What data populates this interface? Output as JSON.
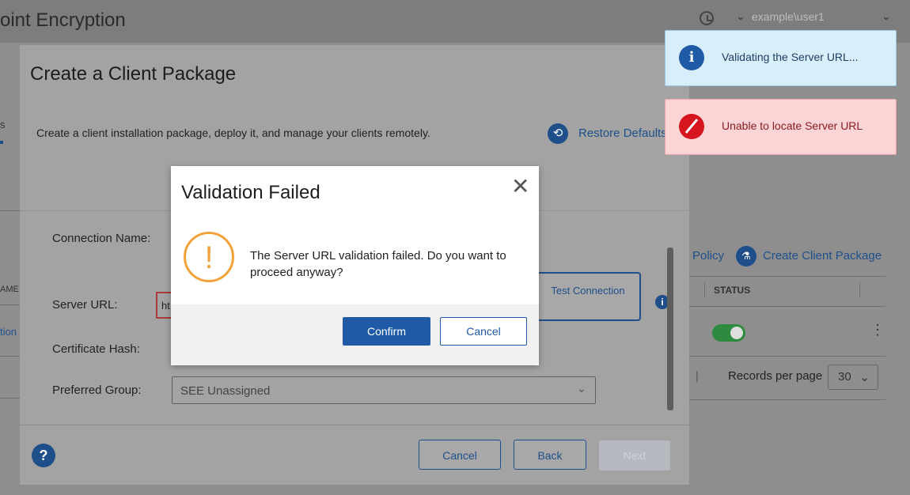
{
  "app": {
    "title": "oint Encryption"
  },
  "header": {
    "user": "example\\user1",
    "user_chevron": "⌄",
    "menu_chevron": "⌄"
  },
  "background": {
    "left_tab": "s",
    "left_col_header": "AME",
    "left_row": "tion",
    "policy_link": "Policy",
    "create_package_link": "Create Client Package",
    "status_header": "STATUS",
    "records_per_page_label": "Records per page",
    "records_per_page_value": "30",
    "pager_glyph": "❘",
    "kebab": "⋮"
  },
  "wizard": {
    "title": "Create a Client Package",
    "description": "Create a client installation package, deploy it, and manage your clients remotely.",
    "restore_defaults": "Restore Defaults",
    "connection_name_label": "Connection Name:",
    "server_url_label": "Server URL:",
    "server_url_value": "ht",
    "test_connection": "Test Connection",
    "certificate_hash_label": "Certificate Hash:",
    "preferred_group_label": "Preferred Group:",
    "preferred_group_value": "SEE Unassigned",
    "cancel": "Cancel",
    "back": "Back",
    "next": "Next",
    "help": "?"
  },
  "dialog": {
    "title": "Validation Failed",
    "message": "The Server URL validation failed. Do you want to proceed anyway?",
    "confirm": "Confirm",
    "cancel": "Cancel",
    "close": "✕",
    "warn": "!"
  },
  "toasts": [
    {
      "type": "info",
      "icon": "i",
      "text": "Validating the Server URL..."
    },
    {
      "type": "error",
      "text": "Unable to locate Server URL"
    }
  ],
  "colors": {
    "accent": "#1f5aa6",
    "warning": "#f2a23a",
    "error": "#d6151f",
    "info_bg": "#d8eefb",
    "error_bg": "#fbd4d5"
  }
}
